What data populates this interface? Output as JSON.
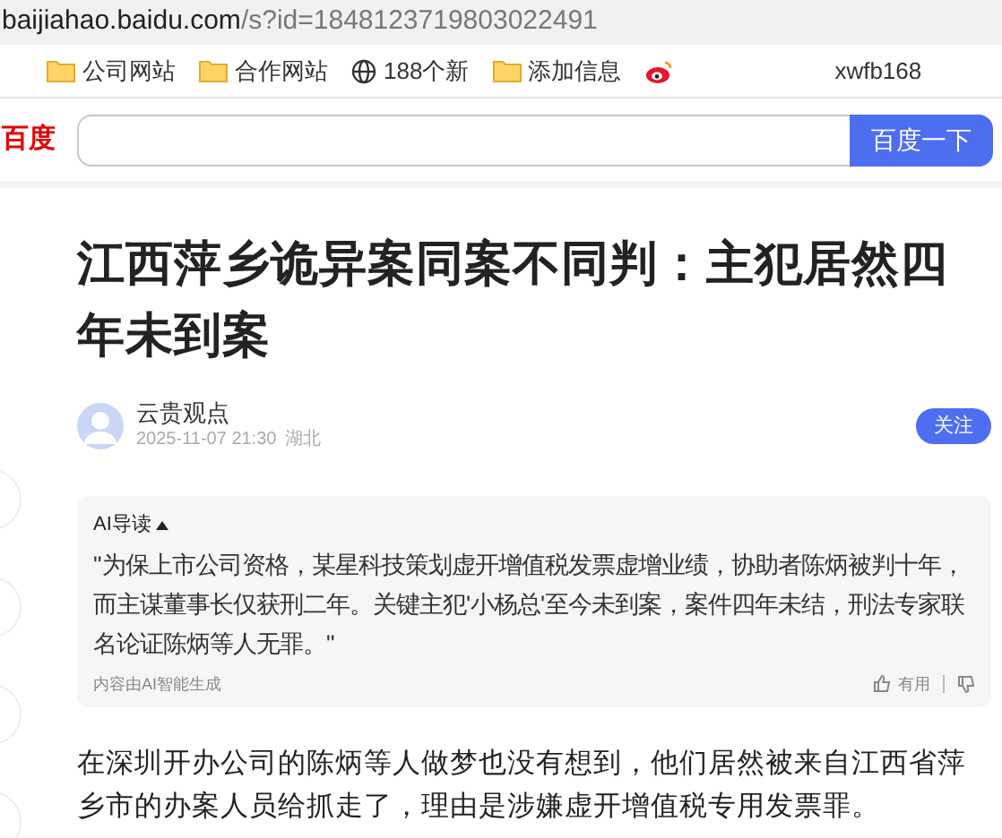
{
  "address_bar": {
    "host": "baijiahao.baidu.com",
    "path": "/s?id=1848123719803022491"
  },
  "bookmarks": [
    {
      "kind": "folder",
      "label": "公司网站"
    },
    {
      "kind": "folder",
      "label": "合作网站"
    },
    {
      "kind": "globe",
      "label": "188个新"
    },
    {
      "kind": "folder",
      "label": "添加信息"
    },
    {
      "kind": "weibo"
    },
    {
      "kind": "text",
      "label": "xwfb168"
    }
  ],
  "header": {
    "logo": "百度",
    "search_button": "百度一下"
  },
  "article": {
    "title": "江西萍乡诡异案同案不同判：主犯居然四年未到案",
    "author": {
      "name": "云贵观点",
      "date": "2025-11-07 21:30",
      "location": "湖北",
      "follow_button": "关注"
    },
    "ai_summary": {
      "heading": "AI导读",
      "expanded": true,
      "text": "\"为保上市公司资格，某星科技策划虚开增值税发票虚增业绩，协助者陈炳被判十年，而主谋董事长仅获刑二年。关键主犯'小杨总'至今未到案，案件四年未结，刑法专家联名论证陈炳等人无罪。\"",
      "note": "内容由AI智能生成",
      "useful": "有用"
    },
    "paragraphs": [
      "在深圳开办公司的陈炳等人做梦也没有想到，他们居然被来自江西省萍乡市的办案人员给抓走了，理由是涉嫌虚开增值税专用发票罪。"
    ]
  }
}
